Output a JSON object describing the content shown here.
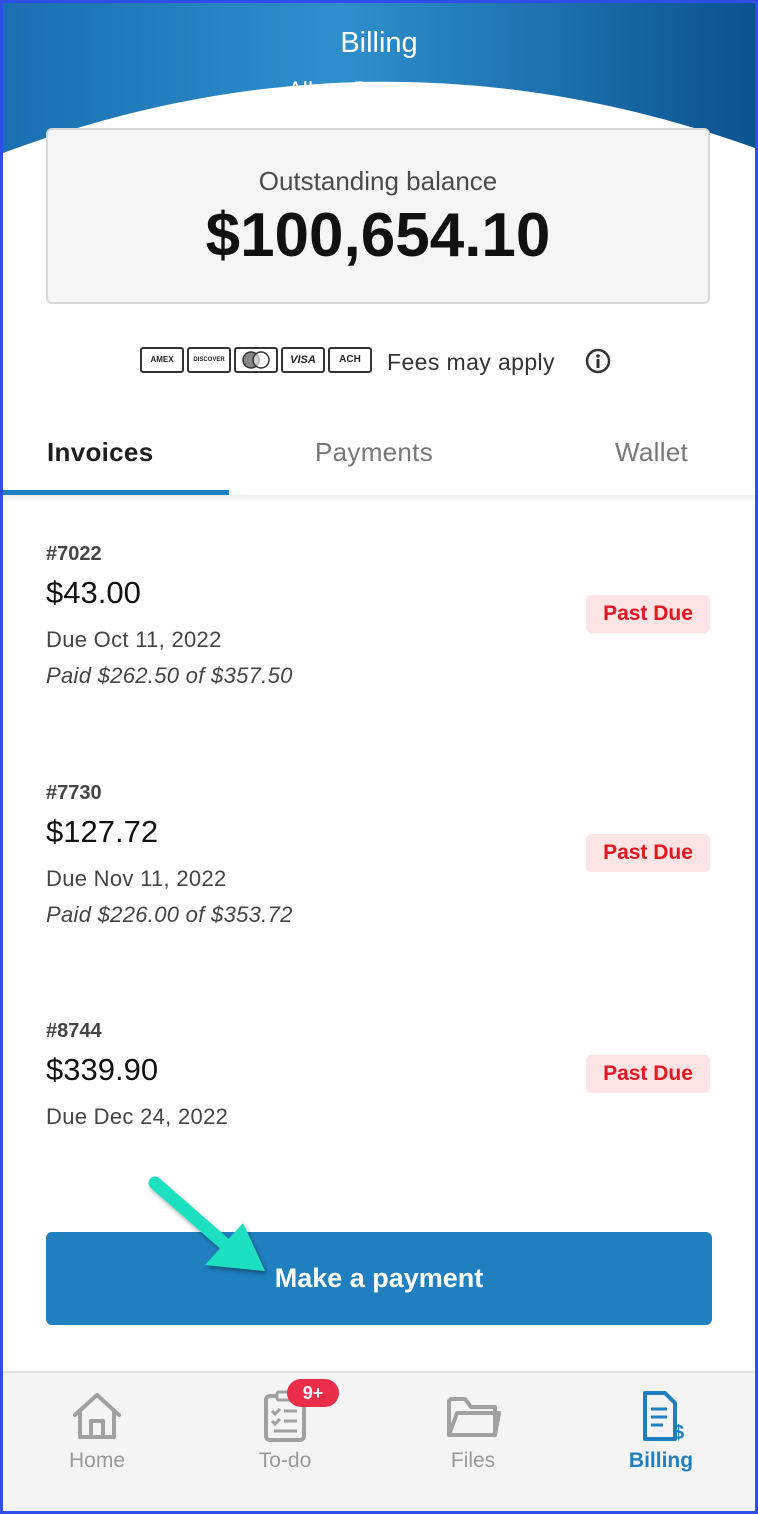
{
  "header": {
    "title": "Billing",
    "subtitle": "Albert Brennaman"
  },
  "balance": {
    "label": "Outstanding balance",
    "amount": "$100,654.10"
  },
  "payment_methods": {
    "cards": [
      "AMEX",
      "DISCOVER",
      "mastercard",
      "VISA",
      "ACH"
    ],
    "fees_text": "Fees may apply",
    "info_icon": "info-icon"
  },
  "tabs": [
    {
      "label": "Invoices",
      "active": true
    },
    {
      "label": "Payments",
      "active": false
    },
    {
      "label": "Wallet",
      "active": false
    }
  ],
  "invoices": [
    {
      "number": "#7022",
      "amount": "$43.00",
      "due": "Due Oct 11, 2022",
      "paid": "Paid $262.50 of $357.50",
      "status": "Past Due"
    },
    {
      "number": "#7730",
      "amount": "$127.72",
      "due": "Due Nov 11, 2022",
      "paid": "Paid $226.00 of $353.72",
      "status": "Past Due"
    },
    {
      "number": "#8744",
      "amount": "$339.90",
      "due": "Due Dec 24, 2022",
      "paid": "",
      "status": "Past Due"
    }
  ],
  "actions": {
    "make_payment": "Make a payment"
  },
  "bottom_nav": [
    {
      "label": "Home",
      "icon": "home-icon",
      "active": false
    },
    {
      "label": "To-do",
      "icon": "checklist-icon",
      "active": false,
      "badge": "9+"
    },
    {
      "label": "Files",
      "icon": "folder-icon",
      "active": false
    },
    {
      "label": "Billing",
      "icon": "billing-document-icon",
      "active": true
    }
  ],
  "colors": {
    "primary": "#1f7fbf",
    "header_dark": "#0f5f9c",
    "past_due_text": "#e2171f",
    "past_due_bg": "#fde4e4",
    "badge": "#ec2d4a",
    "annotation_arrow": "#1de0c0"
  }
}
